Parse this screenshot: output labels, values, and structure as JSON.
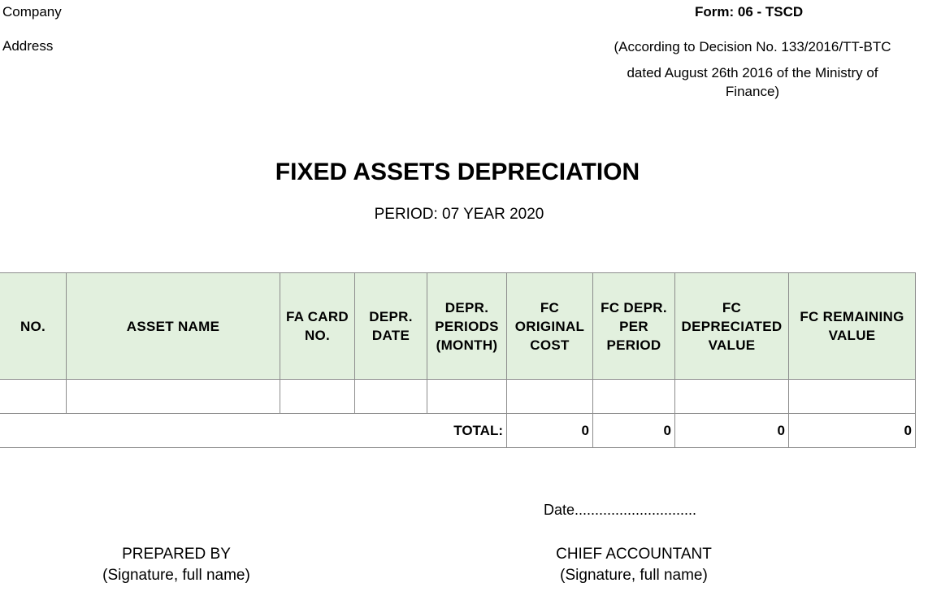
{
  "header": {
    "company": "Company",
    "address": "Address",
    "form_code": "Form: 06 - TSCD",
    "decision_line1": "(According to Decision No. 133/2016/TT-BTC",
    "decision_line2": "dated August 26th 2016 of the Ministry of",
    "decision_line3": "Finance)"
  },
  "title": "FIXED ASSETS DEPRECIATION",
  "period": "PERIOD: 07 YEAR 2020",
  "table": {
    "header_color": "#e2f0de",
    "columns": [
      "NO.",
      "ASSET NAME",
      "FA CARD NO.",
      "DEPR. DATE",
      "DEPR. PERIODS (MONTH)",
      "FC ORIGINAL COST",
      "FC DEPR. PER PERIOD",
      "FC DEPRECIATED VALUE",
      "FC REMAINING VALUE"
    ],
    "rows": [
      [
        "",
        "",
        "",
        "",
        "",
        "",
        "",
        "",
        ""
      ]
    ],
    "total": {
      "label": "TOTAL:",
      "original_cost": "0",
      "depr_per_period": "0",
      "depreciated_value": "0",
      "remaining_value": "0"
    }
  },
  "footer": {
    "date_line": "Date..............................",
    "prepared_by": "PREPARED BY",
    "prepared_sig": "(Signature, full name)",
    "chief_accountant": "CHIEF ACCOUNTANT",
    "chief_sig": "(Signature, full name)"
  }
}
